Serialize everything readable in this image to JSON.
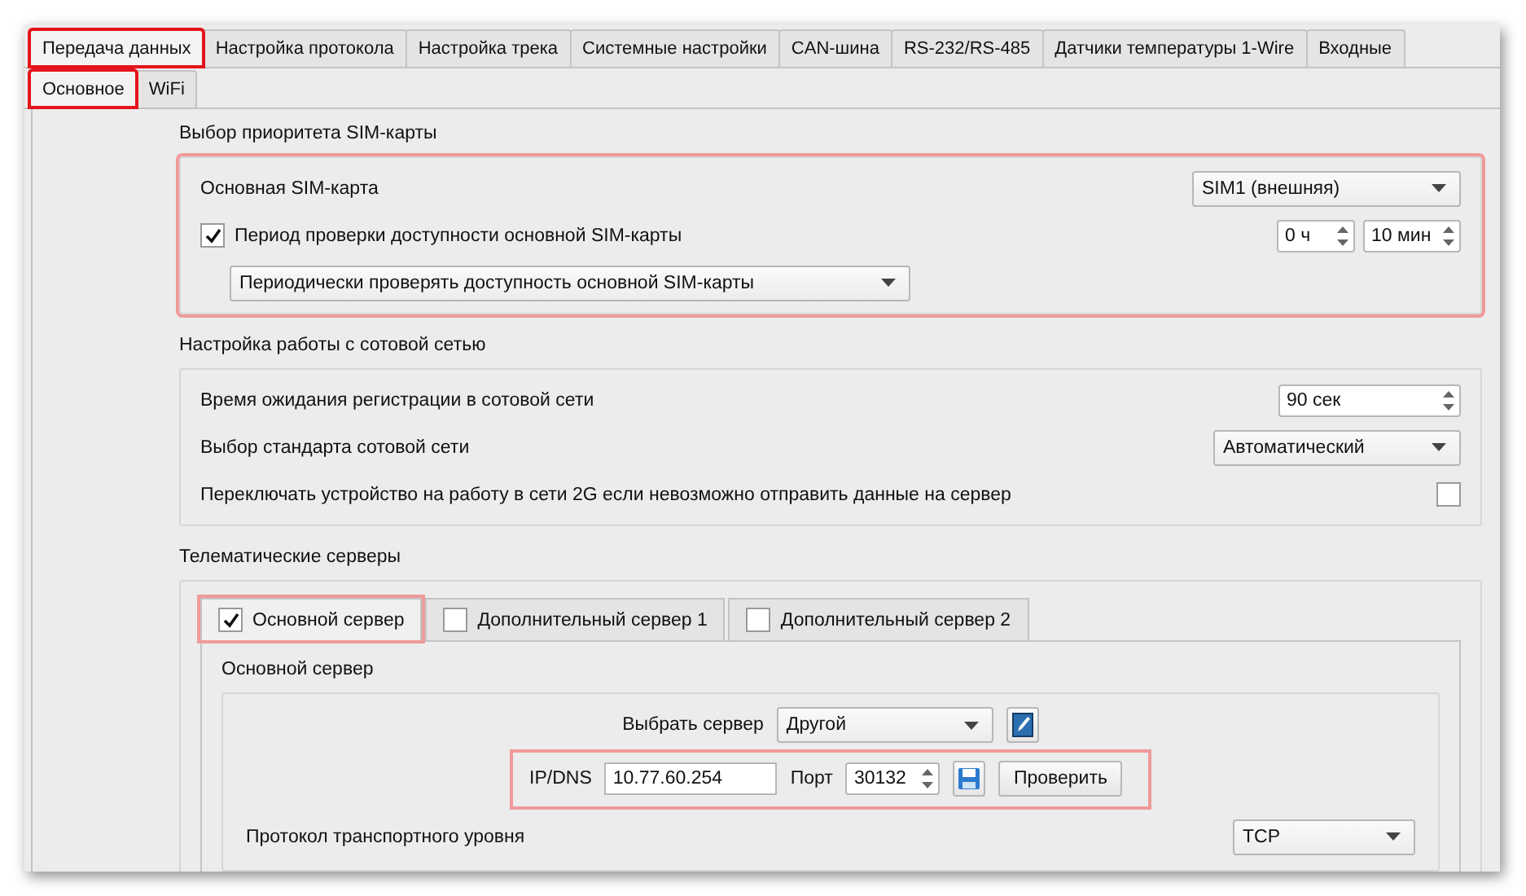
{
  "tabs": [
    {
      "label": "Передача данных",
      "selected": true,
      "highlighted": true
    },
    {
      "label": "Настройка протокола",
      "selected": false,
      "highlighted": false
    },
    {
      "label": "Настройка трека",
      "selected": false,
      "highlighted": false
    },
    {
      "label": "Системные настройки",
      "selected": false,
      "highlighted": false
    },
    {
      "label": "CAN-шина",
      "selected": false,
      "highlighted": false
    },
    {
      "label": "RS-232/RS-485",
      "selected": false,
      "highlighted": false
    },
    {
      "label": "Датчики температуры 1-Wire",
      "selected": false,
      "highlighted": false
    },
    {
      "label": "Входные",
      "selected": false,
      "highlighted": false
    }
  ],
  "subtabs": [
    {
      "label": "Основное",
      "selected": true,
      "highlighted": true
    },
    {
      "label": "WiFi",
      "selected": false,
      "highlighted": false
    }
  ],
  "sim_priority": {
    "title": "Выбор приоритета SIM-карты",
    "highlighted": true,
    "main_sim": {
      "label": "Основная SIM-карта",
      "value": "SIM1 (внешняя)"
    },
    "check_period": {
      "label": "Период проверки доступности основной SIM-карты",
      "checked": true,
      "hours": "0 ч",
      "minutes": "10 мин"
    },
    "mode": {
      "value": "Периодически проверять доступность основной SIM-карты"
    }
  },
  "cellular": {
    "title": "Настройка работы с сотовой сетью",
    "registration_timeout": {
      "label": "Время ожидания регистрации в сотовой сети",
      "value": "90 сек"
    },
    "network_standard": {
      "label": "Выбор стандарта сотовой сети",
      "value": "Автоматический"
    },
    "switch_2g": {
      "label": "Переключать устройство на работу в сети 2G если невозможно отправить данные на сервер",
      "checked": false
    }
  },
  "servers": {
    "title": "Телематические серверы",
    "tabs": [
      {
        "label": "Основной сервер",
        "checked": true,
        "selected": true,
        "highlighted": true
      },
      {
        "label": "Дополнительный сервер 1",
        "checked": false,
        "selected": false,
        "highlighted": false
      },
      {
        "label": "Дополнительный сервер 2",
        "checked": false,
        "selected": false,
        "highlighted": false
      }
    ],
    "panel_title": "Основной сервер",
    "select_server": {
      "label": "Выбрать сервер",
      "value": "Другой"
    },
    "address": {
      "highlighted": true,
      "ip_label": "IP/DNS",
      "ip": "10.77.60.254",
      "port_label": "Порт",
      "port": "30132",
      "check_button": "Проверить"
    },
    "transport": {
      "label": "Протокол транспортного уровня",
      "value": "TCP"
    }
  }
}
